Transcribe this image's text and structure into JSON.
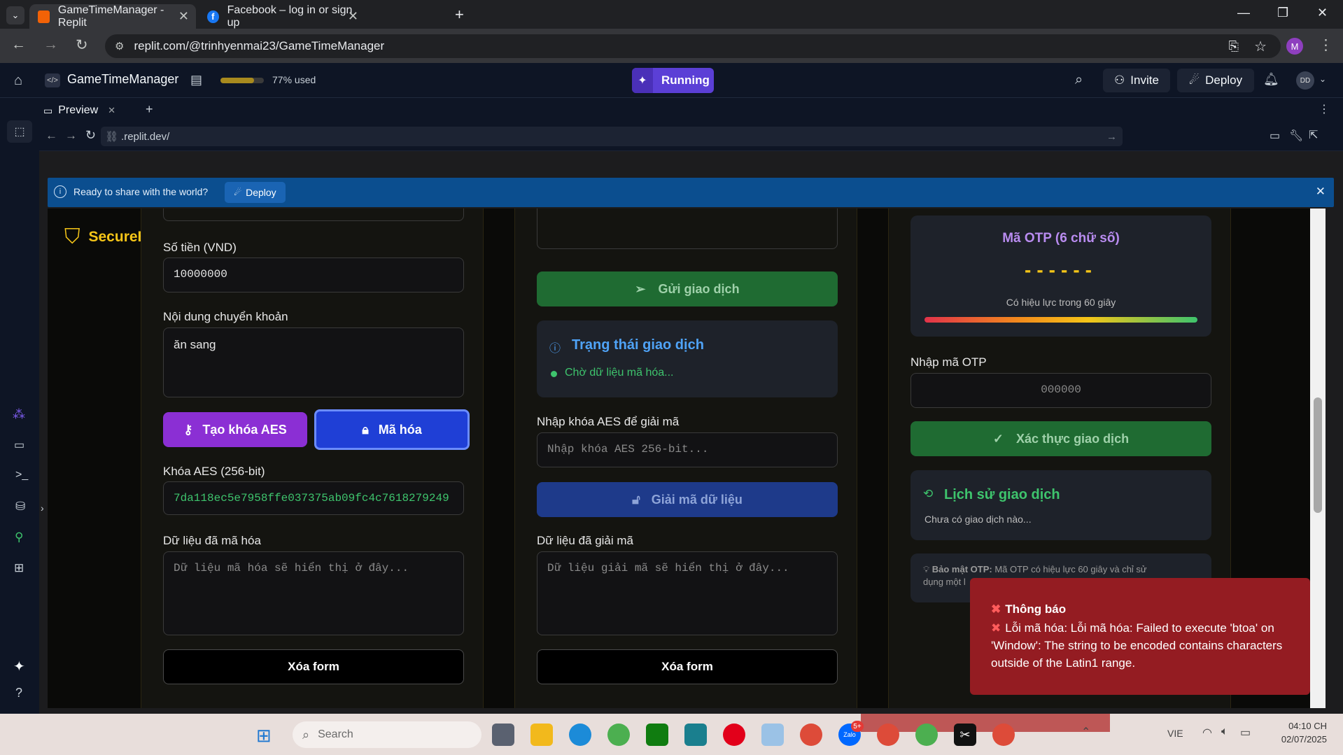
{
  "browser": {
    "tabs": [
      {
        "title": "GameTimeManager - Replit",
        "active": true
      },
      {
        "title": "Facebook – log in or sign up",
        "active": false
      }
    ],
    "url": "replit.com/@trinhyenmai23/GameTimeManager",
    "profile_initial": "M"
  },
  "replit": {
    "project_name": "GameTimeManager",
    "usage_text": "77% used",
    "usage_percent": 77,
    "run_label": "Running",
    "invite_label": "Invite",
    "deploy_label": "Deploy",
    "avatar_initials": "DD",
    "preview_tab_label": "Preview",
    "preview_url": ".replit.dev/",
    "banner_text": "Ready to share with the world?",
    "banner_button": "Deploy"
  },
  "app": {
    "brand": "SecureBank Pro",
    "col1": {
      "amount_label": "Số tiền (VND)",
      "amount_value": "10000000",
      "memo_label": "Nội dung chuyển khoản",
      "memo_value": "ăn sang",
      "gen_key_button": "Tạo khóa AES",
      "encrypt_button": "Mã hóa",
      "aes_key_label": "Khóa AES (256-bit)",
      "aes_key_value": "7da118ec5e7958ffe037375ab09fc4c7618279249",
      "encrypted_label": "Dữ liệu đã mã hóa",
      "encrypted_placeholder": "Dữ liệu mã hóa sẽ hiển thị ở đây...",
      "clear_button": "Xóa form"
    },
    "col2": {
      "send_button": "Gửi giao dịch",
      "status_title": "Trạng thái giao dịch",
      "status_text": "Chờ dữ liệu mã hóa...",
      "decrypt_key_label": "Nhập khóa AES để giải mã",
      "decrypt_key_placeholder": "Nhập khóa AES 256-bit...",
      "decrypt_button": "Giải mã dữ liệu",
      "decrypted_label": "Dữ liệu đã giải mã",
      "decrypted_placeholder": "Dữ liệu giải mã sẽ hiển thị ở đây...",
      "clear_button": "Xóa form"
    },
    "col3": {
      "otp_title": "Mã OTP (6 chữ số)",
      "otp_value": "------",
      "otp_validity": "Có hiệu lực trong 60 giây",
      "otp_input_label": "Nhập mã OTP",
      "otp_input_placeholder": "000000",
      "verify_button": "Xác thực giao dịch",
      "history_title": "Lịch sử giao dịch",
      "history_empty": "Chưa có giao dịch nào...",
      "security_note_bold": "Bảo mật OTP:",
      "security_note_text": " Mã OTP có hiệu lực 60 giây và chỉ sử",
      "security_note_line2": "dụng một l"
    },
    "toast": {
      "title": "Thông báo",
      "message": "Lỗi mã hóa: Lỗi mã hóa: Failed to execute 'btoa' on 'Window': The string to be encoded contains characters outside of the Latin1 range."
    }
  },
  "taskbar": {
    "search_placeholder": "Search",
    "language": "VIE",
    "time": "04:10 CH",
    "date": "02/07/2025",
    "badge": "5+"
  },
  "colors": {
    "purple": "#8b2fd4",
    "blue_button": "#1f3fd6",
    "green_button": "#1f6b32",
    "gold": "#f5c518",
    "toast_red": "#941c22",
    "replit_running": "#5b3fd6"
  }
}
